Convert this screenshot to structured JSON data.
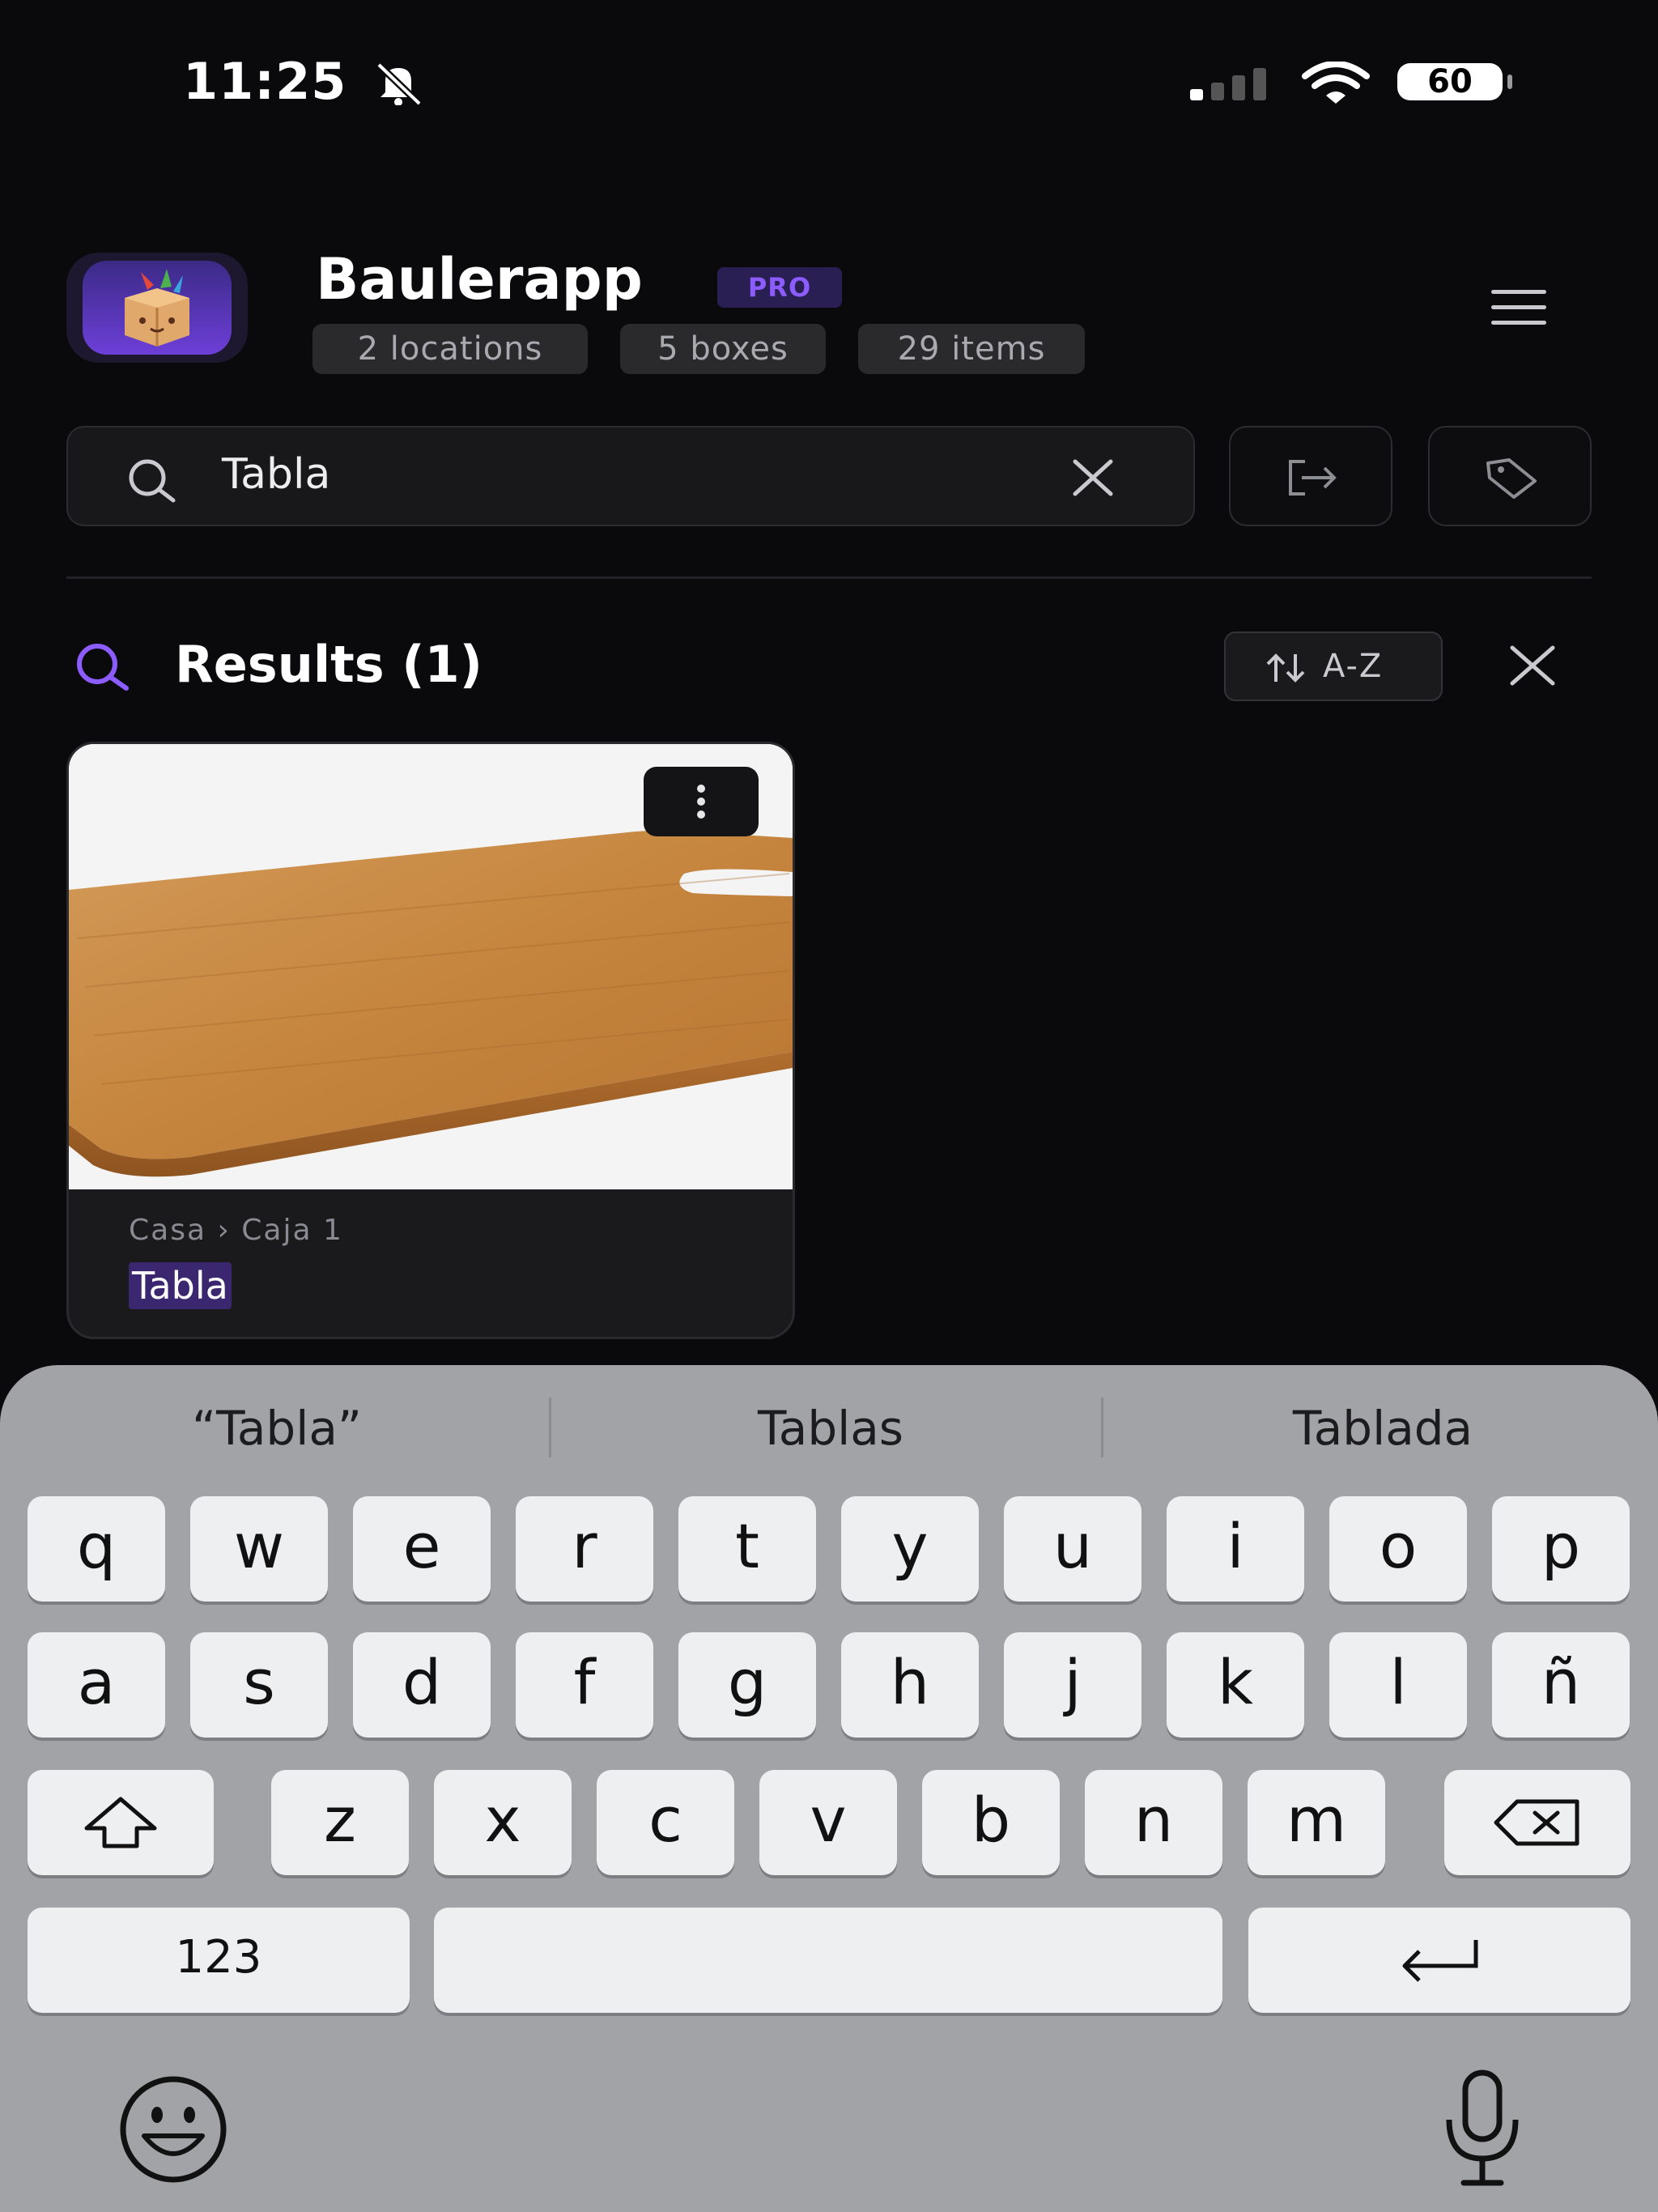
{
  "status_bar": {
    "time": "11:25",
    "battery": "60"
  },
  "header": {
    "app_name": "Baulerapp",
    "badge": "PRO",
    "stats": [
      "2 locations",
      "5 boxes",
      "29 items"
    ]
  },
  "search": {
    "value": "Tabla"
  },
  "results": {
    "title": "Results (1)",
    "sort_label": "A-Z",
    "items": [
      {
        "path": "Casa › Caja 1",
        "name": "Tabla"
      }
    ]
  },
  "keyboard": {
    "suggestions": [
      "“Tabla”",
      "Tablas",
      "Tablada"
    ],
    "row1": [
      "q",
      "w",
      "e",
      "r",
      "t",
      "y",
      "u",
      "i",
      "o",
      "p"
    ],
    "row2": [
      "a",
      "s",
      "d",
      "f",
      "g",
      "h",
      "j",
      "k",
      "l",
      "ñ"
    ],
    "row3": [
      "z",
      "x",
      "c",
      "v",
      "b",
      "n",
      "m"
    ],
    "numbers_label": "123"
  },
  "colors": {
    "accent": "#8c5cff",
    "background": "#0a0a0d",
    "keyboard": "#a2a3a7"
  }
}
